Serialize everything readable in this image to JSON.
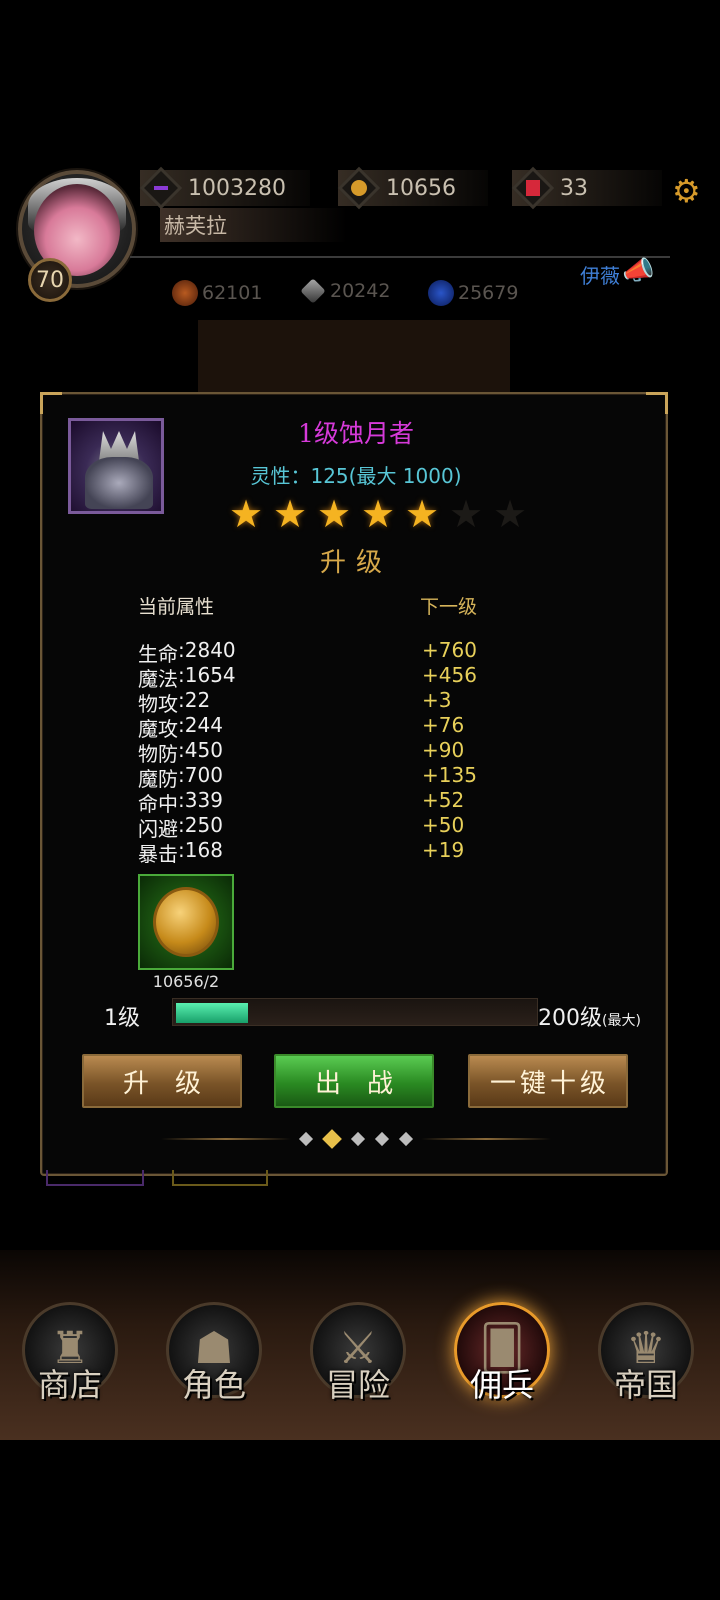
{
  "hud": {
    "player_level": "70",
    "player_name": "赫芙拉",
    "resources": [
      {
        "icon": "purple-crystal-icon",
        "value": "1003280"
      },
      {
        "icon": "gold-coin-icon",
        "value": "10656"
      },
      {
        "icon": "red-gem-icon",
        "value": "33"
      }
    ],
    "mini_stats": [
      {
        "icon": "fire-orb-icon",
        "value": "62101"
      },
      {
        "icon": "sword-icon",
        "value": "20242"
      },
      {
        "icon": "blue-orb-icon",
        "value": "25679"
      }
    ],
    "chat_name": "伊薇"
  },
  "mercenary": {
    "title": "1级蚀月者",
    "spirit": "灵性：125(最大 1000)",
    "stars_total": 7,
    "stars_filled": 5,
    "upgrade_heading": "升级",
    "current_header": "当前属性",
    "next_header": "下一级",
    "stats": [
      {
        "label": "生命",
        "value": "2840",
        "inc": "+760"
      },
      {
        "label": "魔法",
        "value": "1654",
        "inc": "+456"
      },
      {
        "label": "物攻",
        "value": "22",
        "inc": "+3"
      },
      {
        "label": "魔攻",
        "value": "244",
        "inc": "+76"
      },
      {
        "label": "物防",
        "value": "450",
        "inc": "+90"
      },
      {
        "label": "魔防",
        "value": "700",
        "inc": "+135"
      },
      {
        "label": "命中",
        "value": "339",
        "inc": "+52"
      },
      {
        "label": "闪避",
        "value": "250",
        "inc": "+50"
      },
      {
        "label": "暴击",
        "value": "168",
        "inc": "+19"
      }
    ],
    "cost": "10656/2",
    "level_min": "1级",
    "level_max": "200级",
    "level_max_note": "(最大)",
    "progress_fraction": 0.2
  },
  "buttons": {
    "upgrade": "升级",
    "deploy": "出战",
    "ten_levels": "一键十级"
  },
  "pager": {
    "count": 5,
    "active": 1
  },
  "nav": [
    {
      "label": "商店",
      "icon": "castle-icon"
    },
    {
      "label": "角色",
      "icon": "hood-icon"
    },
    {
      "label": "冒险",
      "icon": "crossed-swords-icon"
    },
    {
      "label": "佣兵",
      "icon": "cards-icon"
    },
    {
      "label": "帝国",
      "icon": "crown-icon"
    }
  ],
  "colors": {
    "title_magenta": "#d63ad9",
    "spirit_cyan": "#58c6d6",
    "gold": "#d6a84a",
    "increment_yellow": "#e8d05a"
  }
}
